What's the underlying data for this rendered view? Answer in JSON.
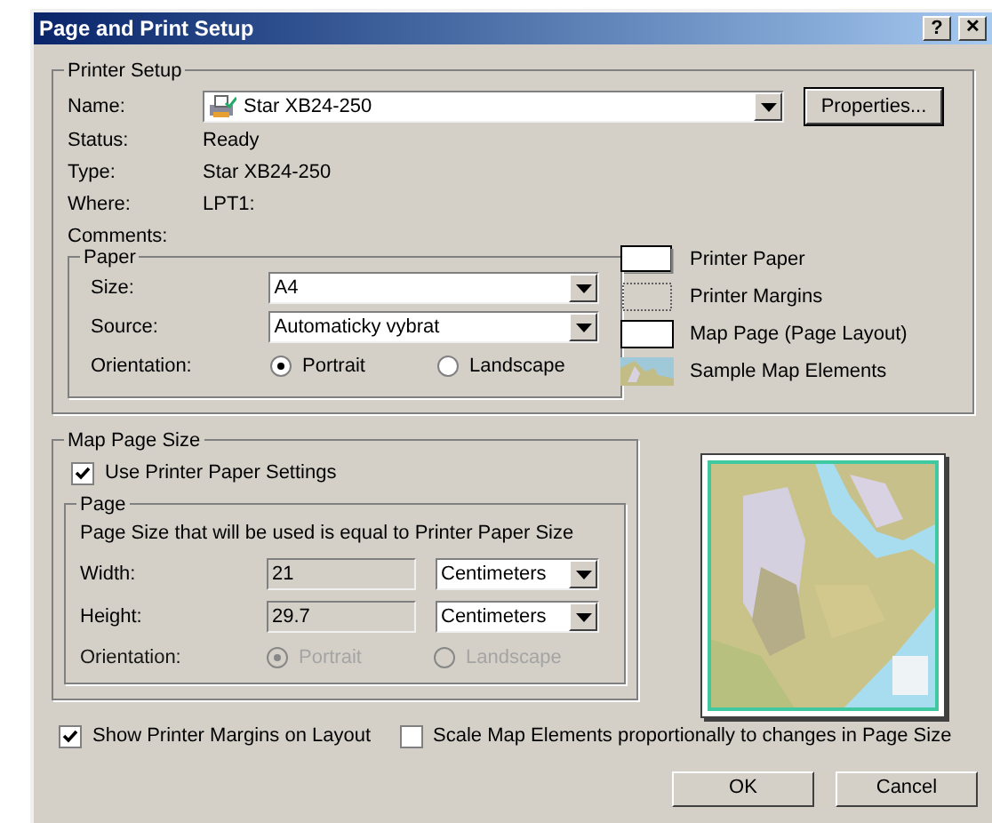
{
  "window": {
    "title": "Page and Print Setup",
    "buttons": [
      {
        "kind": "help",
        "label": "?"
      },
      {
        "kind": "close",
        "label": "✕"
      }
    ]
  },
  "printer_setup": {
    "title": "Printer Setup",
    "name_label": "Name:",
    "name_value": "Star XB24-250",
    "properties_button": "Properties...",
    "info": [
      {
        "label": "Status:",
        "value": "Ready"
      },
      {
        "label": "Type:",
        "value": "Star XB24-250"
      },
      {
        "label": "Where:",
        "value": "LPT1:"
      },
      {
        "label": "Comments:"
      }
    ],
    "paper": {
      "title": "Paper",
      "size_label": "Size:",
      "size_value": "A4",
      "source_label": "Source:",
      "source_value": "Automaticky vybrat",
      "orientation_label": "Orientation:",
      "orientation": [
        {
          "label": "Portrait",
          "selected": true
        },
        {
          "label": "Landscape",
          "selected": false
        }
      ]
    }
  },
  "legend": [
    {
      "kind": "paper",
      "label": "Printer Paper"
    },
    {
      "kind": "margins",
      "label": "Printer Margins"
    },
    {
      "kind": "page",
      "label": "Map Page (Page Layout)"
    },
    {
      "kind": "elements",
      "label": "Sample Map Elements"
    }
  ],
  "map_page_size": {
    "title": "Map Page Size",
    "use_printer_paper": {
      "label": "Use Printer Paper Settings",
      "checked": true
    },
    "page": {
      "title": "Page",
      "note": "Page Size that will be used is equal to Printer Paper Size",
      "rows": [
        {
          "label": "Width:",
          "value": "21",
          "units": "Centimeters"
        },
        {
          "label": "Height:",
          "value": "29.7",
          "units": "Centimeters"
        }
      ],
      "orientation_label": "Orientation:",
      "orientation_disabled": true,
      "orientation": [
        {
          "label": "Portrait",
          "selected": true
        },
        {
          "label": "Landscape",
          "selected": false
        }
      ]
    }
  },
  "options": [
    {
      "label": "Show Printer Margins on Layout",
      "checked": true
    },
    {
      "label": "Scale Map Elements proportionally to changes in Page Size",
      "checked": false
    }
  ],
  "buttons": [
    "OK",
    "Cancel"
  ]
}
